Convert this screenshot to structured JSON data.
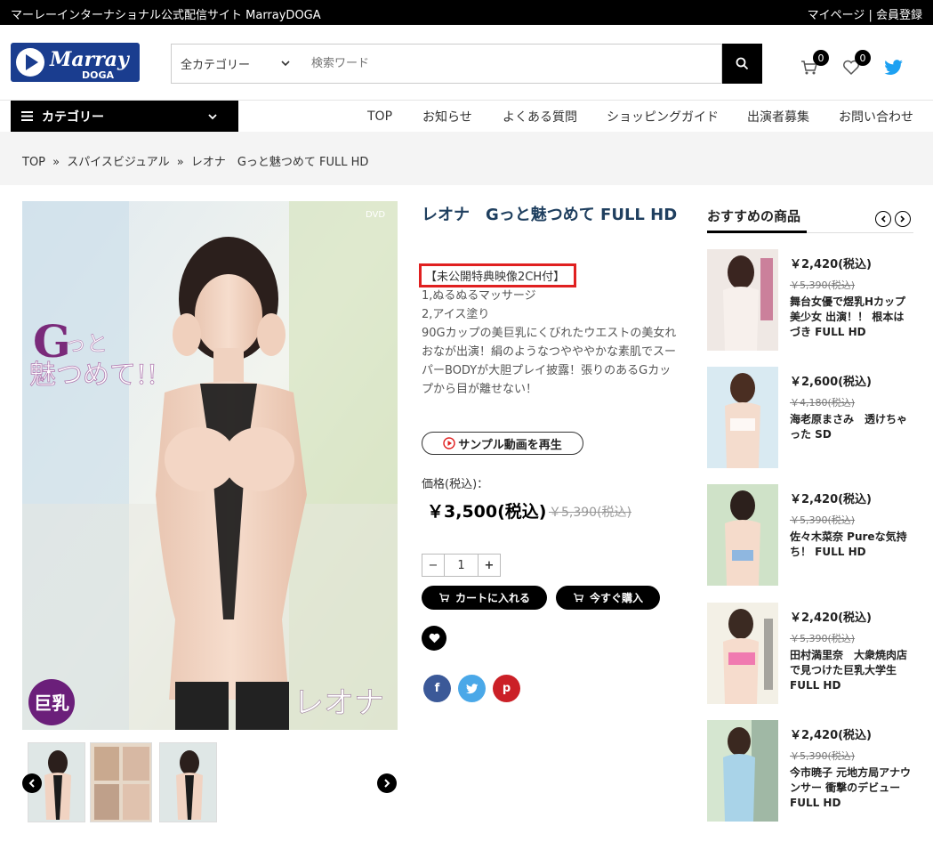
{
  "topbar": {
    "site_name": "マーレーインターナショナル公式配信サイト MarrayDOGA",
    "mypage": "マイページ",
    "separator": "|",
    "register": "会員登録"
  },
  "header": {
    "logo_text_1": "Marray",
    "logo_text_2": "DOGA",
    "category_select": "全カテゴリー",
    "search_placeholder": "検索ワード",
    "cart_count": "0",
    "favorites_count": "0"
  },
  "nav": {
    "category_label": "カテゴリー",
    "items": [
      "TOP",
      "お知らせ",
      "よくある質問",
      "ショッピングガイド",
      "出演者募集",
      "お問い合わせ"
    ]
  },
  "breadcrumb": {
    "items": [
      "TOP",
      "スパイスビジュアル",
      "レオナ　Gっと魅つめて FULL HD"
    ],
    "separator": "»"
  },
  "product": {
    "title": "レオナ　Gっと魅つめて FULL HD",
    "highlight": "【未公開特典映像2CH付】",
    "description_lines": [
      "1,ぬるぬるマッサージ",
      "2,アイス塗り",
      "90Gカップの美巨乳にくびれたウエストの美女れおなが出演！絹のようなつやややかな素肌でスーパーBODYが大胆プレイ披露！張りのあるGカップから目が離せない！"
    ],
    "sample_button": "サンプル動画を再生",
    "price_label": "価格(税込)：",
    "price": "￥3,500(税込)",
    "price_old": "￥5,390(税込)",
    "qty_minus": "−",
    "qty_value": "1",
    "qty_plus": "+",
    "add_to_cart": "カートに入れる",
    "buy_now": "今すぐ購入",
    "cover_title_g": "G",
    "cover_title_rest": "っと",
    "cover_title_2": "魅つめて!!",
    "cover_name": "レオナ",
    "cover_badge": "巨乳",
    "cover_dvd": "DVD",
    "progress_fraction": 0.0
  },
  "share": {
    "facebook": "f",
    "twitter": "t",
    "pinterest": "p"
  },
  "sidebar": {
    "title": "おすすめの商品",
    "items": [
      {
        "price": "￥2,420(税込)",
        "old": "￥5,390(税込)",
        "name": "舞台女優で煜乳Hカップ美少女 出演！！ 根本はづき FULL HD"
      },
      {
        "price": "￥2,600(税込)",
        "old": "￥4,180(税込)",
        "name": "海老原まさみ　透けちゃった SD"
      },
      {
        "price": "￥2,420(税込)",
        "old": "￥5,390(税込)",
        "name": "佐々木菜奈 Pureな気持ち！ FULL HD"
      },
      {
        "price": "￥2,420(税込)",
        "old": "￥5,390(税込)",
        "name": "田村満里奈　大衆焼肉店で見つけた巨乳大学生 FULL HD"
      },
      {
        "price": "￥2,420(税込)",
        "old": "￥5,390(税込)",
        "name": "今市暁子 元地方局アナウンサー 衝撃のデビュー　FULL HD"
      }
    ]
  },
  "colors": {
    "accent": "#1f3f5f",
    "highlight_border": "#e02020",
    "twitter": "#1da1f2",
    "facebook": "#3b5998",
    "pinterest": "#cb2027"
  }
}
